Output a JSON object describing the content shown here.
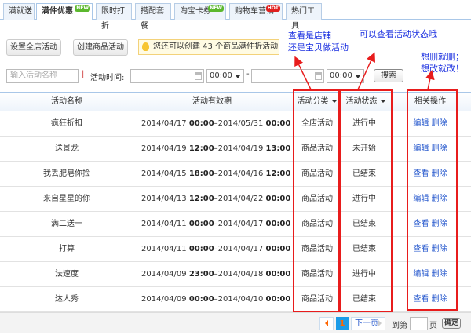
{
  "tabs": [
    {
      "label": "满就送"
    },
    {
      "label": "满件优惠",
      "badge": "NEW",
      "active": true
    },
    {
      "label": "限时打折"
    },
    {
      "label": "搭配套餐"
    },
    {
      "label": "淘宝卡券",
      "badge": "NEW"
    },
    {
      "label": "购物车营销",
      "badge": "HOT"
    },
    {
      "label": "热门工具"
    }
  ],
  "toolbar": {
    "set_store_label": "设置全店活动",
    "create_item_label": "创建商品活动",
    "tip": "您还可以创建 43 个商品满件折活动"
  },
  "filter": {
    "name_placeholder": "输入活动名称",
    "separator": "|",
    "time_label": "活动时间:",
    "start_date": "",
    "start_time": "00:00",
    "dash": "-",
    "end_date": "",
    "end_time": "00:00",
    "search_label": "搜索"
  },
  "annotations": {
    "category": "查看是店铺\n还是宝贝做活动",
    "status": "可以查看活动状态哦",
    "ops": "想删就删；\n想改就改！"
  },
  "table": {
    "headers": {
      "name": "活动名称",
      "period": "活动有效期",
      "category": "活动分类",
      "status": "活动状态",
      "ops": "相关操作"
    },
    "rows": [
      {
        "name": "疯狂折扣",
        "d1": "2014/04/17",
        "t1": "00:00",
        "d2": "2014/05/31",
        "t2": "00:00",
        "category": "全店活动",
        "status": "进行中",
        "op1": "编辑",
        "op2": "删除"
      },
      {
        "name": "送景龙",
        "d1": "2014/04/19",
        "t1": "12:00",
        "d2": "2014/04/19",
        "t2": "13:00",
        "category": "商品活动",
        "status": "未开始",
        "op1": "编辑",
        "op2": "删除"
      },
      {
        "name": "我丢肥皂你捡",
        "d1": "2014/04/15",
        "t1": "18:00",
        "d2": "2014/04/16",
        "t2": "12:00",
        "category": "商品活动",
        "status": "已结束",
        "op1": "查看",
        "op2": "删除"
      },
      {
        "name": "来自星星的你",
        "d1": "2014/04/13",
        "t1": "12:00",
        "d2": "2014/04/22",
        "t2": "00:00",
        "category": "商品活动",
        "status": "进行中",
        "op1": "编辑",
        "op2": "删除"
      },
      {
        "name": "满二送一",
        "d1": "2014/04/11",
        "t1": "00:00",
        "d2": "2014/04/17",
        "t2": "00:00",
        "category": "商品活动",
        "status": "已结束",
        "op1": "查看",
        "op2": "删除"
      },
      {
        "name": "打算",
        "d1": "2014/04/11",
        "t1": "00:00",
        "d2": "2014/04/17",
        "t2": "00:00",
        "category": "商品活动",
        "status": "已结束",
        "op1": "查看",
        "op2": "删除"
      },
      {
        "name": "法速度",
        "d1": "2014/04/09",
        "t1": "23:00",
        "d2": "2014/04/18",
        "t2": "00:00",
        "category": "商品活动",
        "status": "进行中",
        "op1": "编辑",
        "op2": "删除"
      },
      {
        "name": "达人秀",
        "d1": "2014/04/09",
        "t1": "00:00",
        "d2": "2014/04/10",
        "t2": "00:00",
        "category": "商品活动",
        "status": "已结束",
        "op1": "查看",
        "op2": "删除"
      }
    ]
  },
  "pagination": {
    "current": "1",
    "next_label": "下一页",
    "goto_label": "到第",
    "page_unit": "页",
    "page_input": "",
    "confirm_label": "确定"
  },
  "colors": {
    "annotation": "#1a2fe0",
    "highlight": "#e81c1c",
    "link": "#2255cc",
    "new_badge": "#5cb82e",
    "hot_badge": "#e0201f"
  }
}
